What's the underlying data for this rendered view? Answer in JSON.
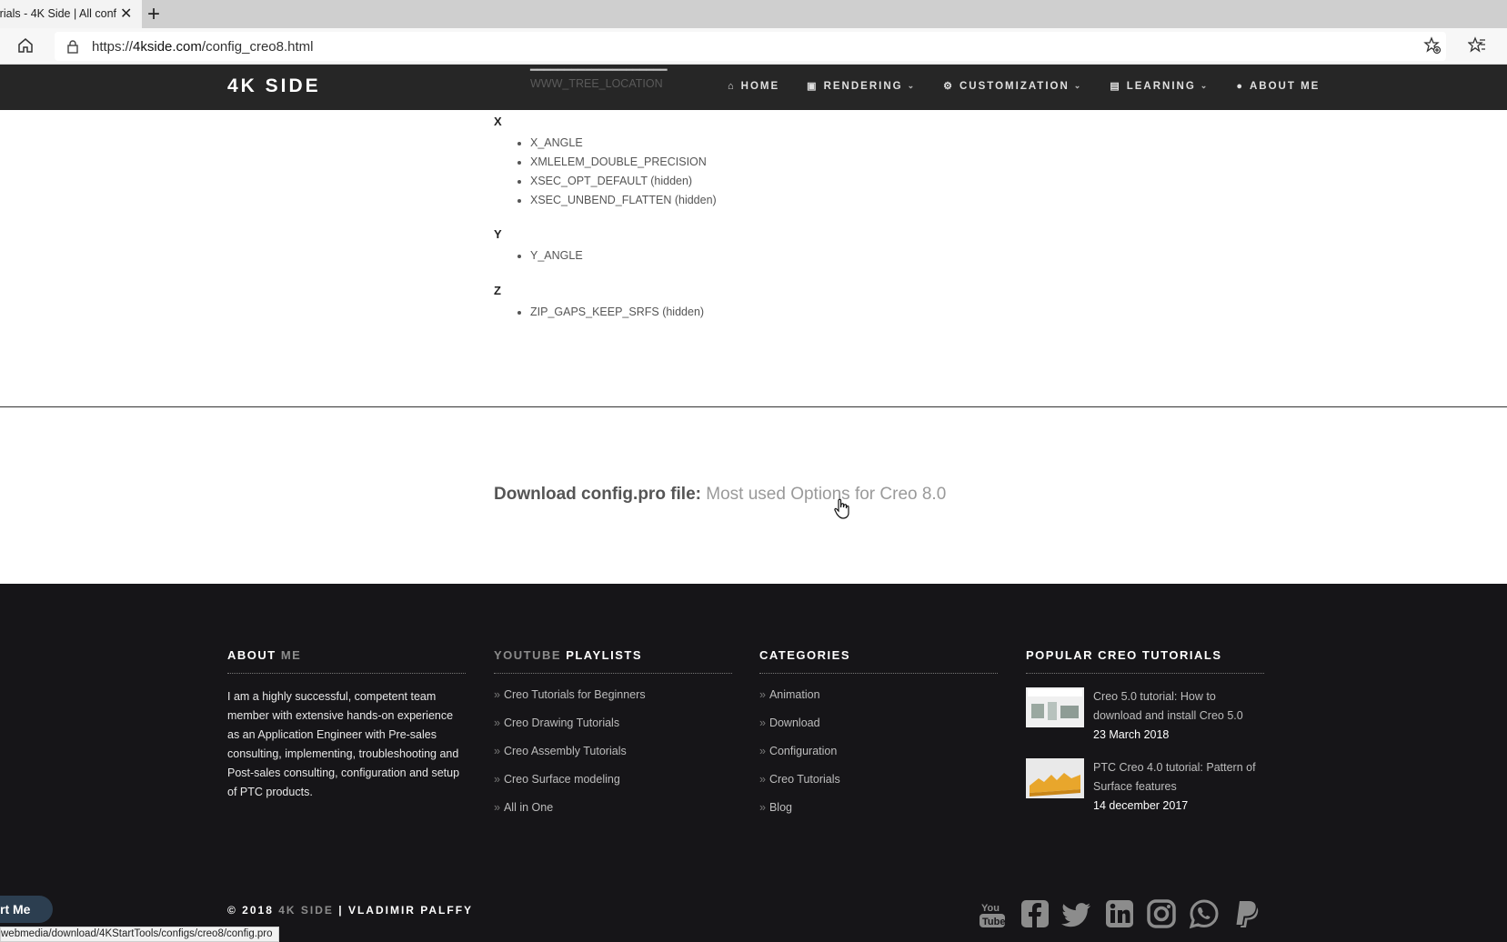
{
  "browser": {
    "tab_title": "orials - 4K Side | All conf",
    "url_prefix": "https://",
    "url_host": "4kside.com",
    "url_path": "/config_creo8.html"
  },
  "site": {
    "logo": "4K SIDE",
    "nav": [
      {
        "label": "HOME",
        "icon": "home-icon",
        "has_dropdown": false
      },
      {
        "label": "RENDERING",
        "icon": "image-icon",
        "has_dropdown": true
      },
      {
        "label": "CUSTOMIZATION",
        "icon": "cogs-icon",
        "has_dropdown": true
      },
      {
        "label": "LEARNING",
        "icon": "book-icon",
        "has_dropdown": true
      },
      {
        "label": "ABOUT ME",
        "icon": "user-icon",
        "has_dropdown": false
      }
    ],
    "partial_items": [
      "WWW_TREE_LOCATION"
    ]
  },
  "content": {
    "groups": [
      {
        "letter": "X",
        "items": [
          "X_ANGLE",
          "XMLELEM_DOUBLE_PRECISION",
          "XSEC_OPT_DEFAULT (hidden)",
          "XSEC_UNBEND_FLATTEN (hidden)"
        ]
      },
      {
        "letter": "Y",
        "items": [
          "Y_ANGLE"
        ]
      },
      {
        "letter": "Z",
        "items": [
          "ZIP_GAPS_KEEP_SRFS (hidden)"
        ]
      }
    ],
    "download_label": "Download config.pro file:",
    "download_link": "Most used Options for Creo 8.0"
  },
  "footer": {
    "about_head_a": "ABOUT",
    "about_head_b": "ME",
    "about_text": "I am a highly successful, competent team member with extensive hands-on experience as an Application Engineer with Pre-sales consulting, implementing, troubleshooting and Post-sales consulting, configuration and setup of PTC products.",
    "youtube_head_a": "YOUTUBE",
    "youtube_head_b": "PLAYLISTS",
    "playlists": [
      "Creo Tutorials for Beginners",
      "Creo Drawing Tutorials",
      "Creo Assembly Tutorials",
      "Creo Surface modeling",
      "All in One"
    ],
    "categories_head": "CATEGORIES",
    "categories": [
      "Animation",
      "Download",
      "Configuration",
      "Creo Tutorials",
      "Blog"
    ],
    "popular_head": "POPULAR CREO TUTORIALS",
    "tutorials": [
      {
        "title": "Creo 5.0 tutorial: How to download and install Creo 5.0",
        "date": "23 March 2018"
      },
      {
        "title": "PTC Creo 4.0 tutorial: Pattern of Surface features",
        "date": "14 december 2017"
      }
    ],
    "copyright_a": "© 2018",
    "copyright_b": "4K SIDE",
    "copyright_c": "| VLADIMIR PALFFY",
    "socials": [
      "youtube-icon",
      "facebook-icon",
      "twitter-icon",
      "linkedin-icon",
      "instagram-icon",
      "whatsapp-icon",
      "paypal-icon"
    ]
  },
  "overlay": {
    "start_button": "rt Me",
    "status_url": "webmedia/download/4KStartTools/configs/creo8/config.pro"
  },
  "colors": {
    "nav_bg": "#262626",
    "footer_bg": "#161518",
    "accent_dim": "#8c8c8c"
  }
}
